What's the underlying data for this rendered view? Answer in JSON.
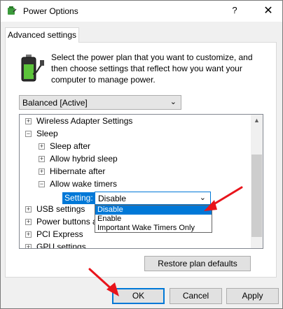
{
  "window": {
    "title": "Power Options",
    "help_label": "?",
    "close_label": "✕"
  },
  "tab": {
    "label": "Advanced settings"
  },
  "instructions": "Select the power plan that you want to customize, and then choose settings that reflect how you want your computer to manage power.",
  "plan_select": {
    "value": "Balanced [Active]"
  },
  "tree": {
    "wireless": "Wireless Adapter Settings",
    "sleep": "Sleep",
    "sleep_after": "Sleep after",
    "hybrid": "Allow hybrid sleep",
    "hibernate": "Hibernate after",
    "wake_timers": "Allow wake timers",
    "usb": "USB settings",
    "power_buttons": "Power buttons a",
    "pci": "PCI Express",
    "gpu": "GPU settings",
    "plus": "+",
    "minus": "−"
  },
  "setting": {
    "label": "Setting:",
    "value": "Disable",
    "options": [
      "Disable",
      "Enable",
      "Important Wake Timers Only"
    ]
  },
  "buttons": {
    "restore": "Restore plan defaults",
    "ok": "OK",
    "cancel": "Cancel",
    "apply": "Apply"
  },
  "icons": {
    "app": "power-options-icon",
    "battery": "battery-plug-icon",
    "chevron": "chevron-down-icon"
  },
  "colors": {
    "accent": "#0078d7",
    "annotation_arrow": "#e8141b"
  }
}
